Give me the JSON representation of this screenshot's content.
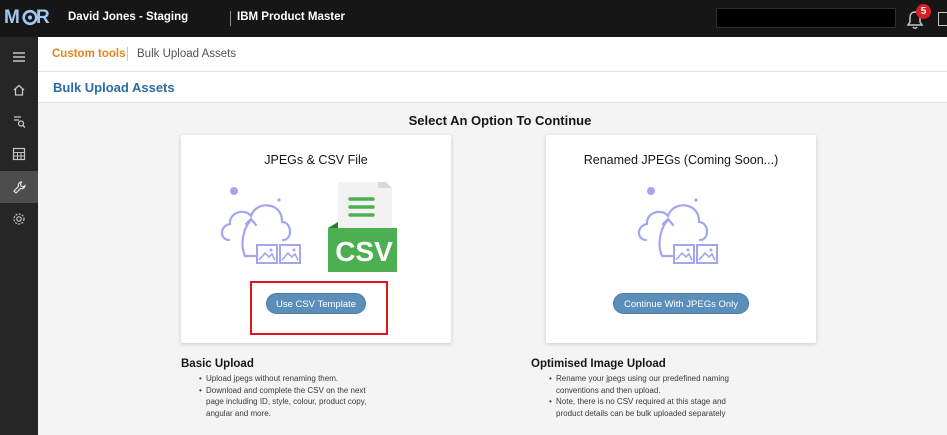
{
  "colors": {
    "topbar": "#161616",
    "rail": "#262626",
    "accent_orange": "#e8841a",
    "title_blue": "#2b6ca3",
    "button_blue": "#5b8fb9",
    "highlight_red": "#e0121b",
    "csv_green": "#4caf50"
  },
  "topbar": {
    "title": "David Jones - Staging",
    "subtitle": "IBM Product Master",
    "notification_count": "5",
    "icons": [
      "logo",
      "bell-icon"
    ]
  },
  "rail": {
    "items": [
      {
        "icon": "menu-icon"
      },
      {
        "icon": "home-icon"
      },
      {
        "icon": "search-list-icon"
      },
      {
        "icon": "grid-icon"
      },
      {
        "icon": "wrench-icon",
        "active": true
      },
      {
        "icon": "settings-icon"
      }
    ]
  },
  "breadcrumb": {
    "parent": "Custom tools",
    "current": "Bulk Upload Assets"
  },
  "page": {
    "title": "Bulk Upload Assets",
    "heading": "Select An Option To Continue"
  },
  "cards": [
    {
      "title": "JPEGs & CSV File",
      "button": "Use CSV Template",
      "csv_label": "CSV"
    },
    {
      "title": "Renamed JPEGs (Coming Soon...)",
      "button": "Continue With JPEGs Only"
    }
  ],
  "descriptions": [
    {
      "title": "Basic Upload",
      "bullets": [
        "Upload jpegs without renaming them.",
        "Download and complete the CSV on the next",
        "page including ID, style, colour, product copy,",
        "angular and more."
      ]
    },
    {
      "title": "Optimised Image Upload",
      "bullets": [
        "Rename your jpegs using our predefined naming",
        "conventions and then upload.",
        "Note, there is no CSV required at this stage and",
        "product details can be bulk uploaded separately"
      ]
    }
  ]
}
